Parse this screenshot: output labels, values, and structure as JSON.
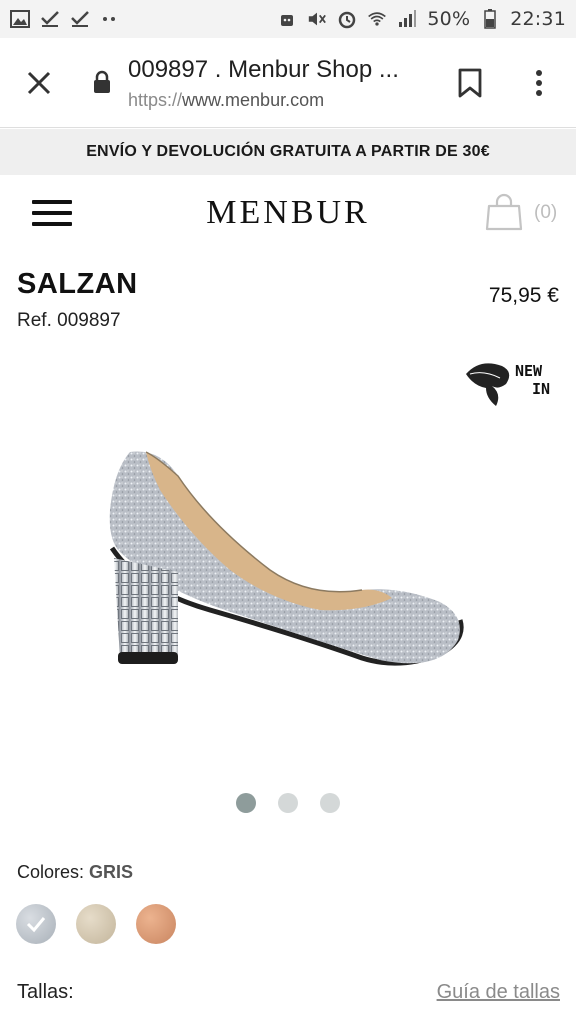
{
  "status_bar": {
    "battery": "50%",
    "time": "22:31",
    "left_icons": [
      "image-icon",
      "check-icon",
      "check-icon",
      "more-dots-icon"
    ],
    "right_icons": [
      "android-icon",
      "mute-icon",
      "alarm-icon",
      "wifi-icon",
      "signal-icon",
      "battery-icon"
    ]
  },
  "browser": {
    "title": "009897 . Menbur Shop ...",
    "url_scheme": "https://",
    "url_host": "www.menbur.com"
  },
  "promo": {
    "text": "ENVÍO Y DEVOLUCIÓN GRATUITA A PARTIR DE 30€"
  },
  "header": {
    "logo": "MENBUR",
    "cart_count": "(0)"
  },
  "product": {
    "name": "SALZAN",
    "ref": "Ref. 009897",
    "price": "75,95 €",
    "badge_line1": "NEW",
    "badge_line2": "IN",
    "image_alt": "Silver glitter pump with jeweled block heel"
  },
  "gallery": {
    "count": 3,
    "active_index": 0
  },
  "colors": {
    "label": "Colores:",
    "selected": "GRIS",
    "swatches": [
      {
        "name": "gris",
        "color": "#b9c0c7",
        "selected": true
      },
      {
        "name": "beige",
        "color": "#d3c7b0",
        "selected": false
      },
      {
        "name": "rosa",
        "color": "#d99a74",
        "selected": false
      }
    ]
  },
  "sizes": {
    "label": "Tallas:",
    "guide": "Guía de tallas"
  },
  "theme": {
    "accent": "#8e9c9b",
    "promo_bg": "#efefef"
  }
}
